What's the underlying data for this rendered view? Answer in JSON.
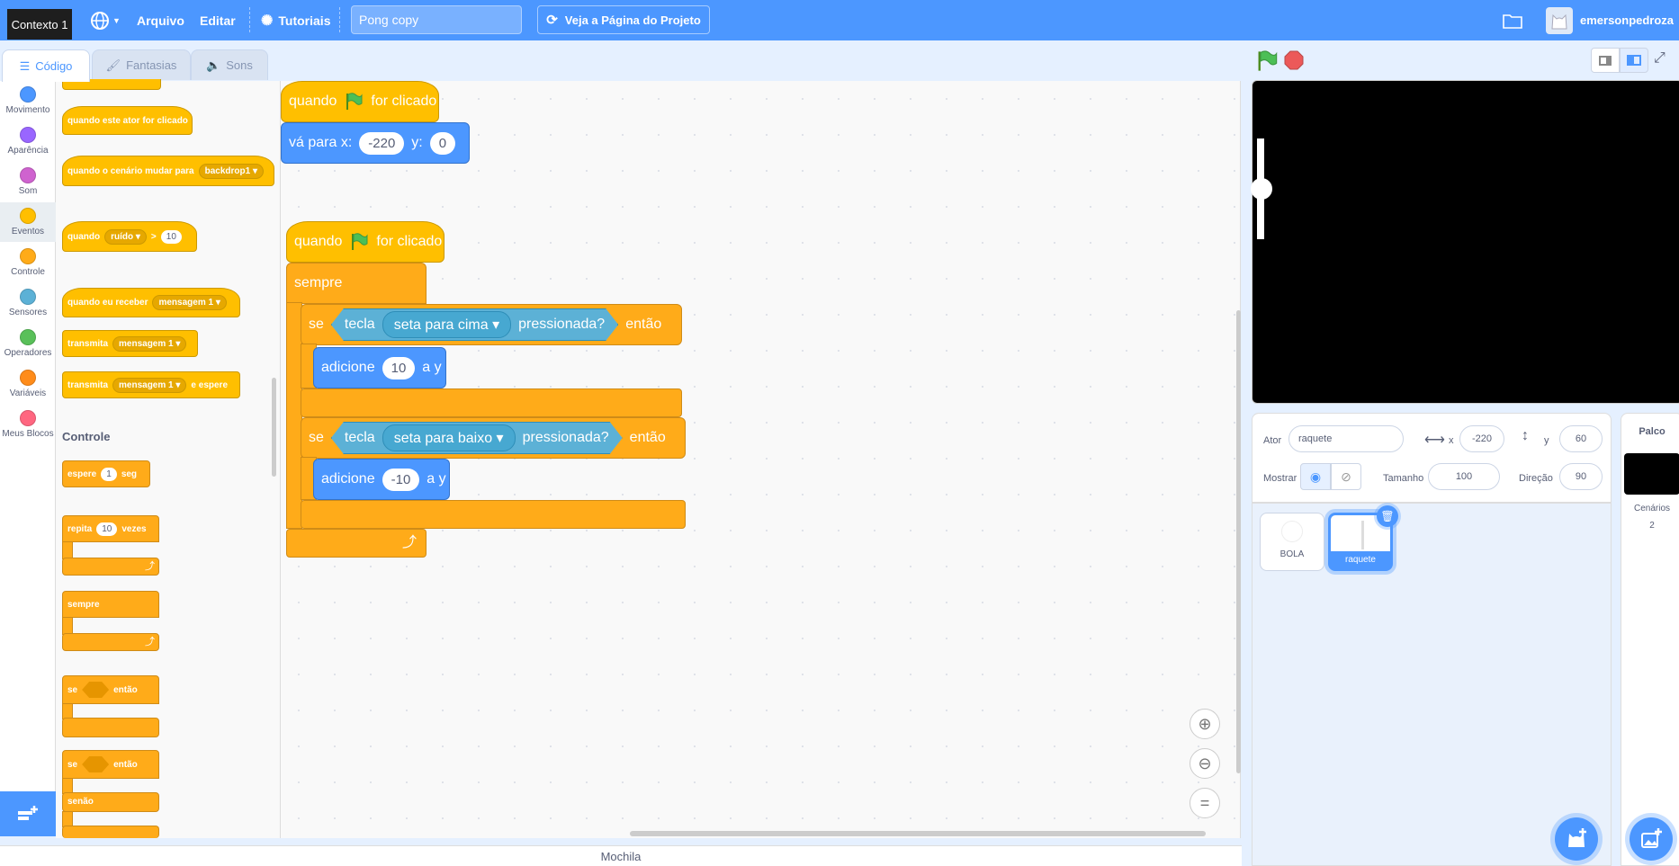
{
  "menubar": {
    "tooltip": "Contexto 1",
    "file": "Arquivo",
    "edit": "Editar",
    "tutorials": "Tutoriais",
    "project_title": "Pong copy",
    "project_page": "Veja a Página do Projeto",
    "username": "emersonpedroza"
  },
  "tabs": {
    "code": "Código",
    "costumes": "Fantasias",
    "sounds": "Sons"
  },
  "categories": [
    {
      "label": "Movimento",
      "color": "#4c97ff"
    },
    {
      "label": "Aparência",
      "color": "#9966ff"
    },
    {
      "label": "Som",
      "color": "#cf63cf"
    },
    {
      "label": "Eventos",
      "color": "#ffbf00"
    },
    {
      "label": "Controle",
      "color": "#ffab19"
    },
    {
      "label": "Sensores",
      "color": "#5cb1d6"
    },
    {
      "label": "Operadores",
      "color": "#59c059"
    },
    {
      "label": "Variáveis",
      "color": "#ff8c1a"
    },
    {
      "label": "Meus Blocos",
      "color": "#ff6680"
    }
  ],
  "palette": {
    "sprite_clicked": "quando este ator for clicado",
    "backdrop_switch": "quando o cenário mudar para",
    "backdrop_value": "backdrop1",
    "when": "quando",
    "loudness": "ruído",
    "gt": ">",
    "gt_value": "10",
    "receive": "quando eu receber",
    "message": "mensagem 1",
    "broadcast": "transmita",
    "broadcast_wait_suffix": "e espere",
    "control_header": "Controle",
    "wait": "espere",
    "wait_value": "1",
    "wait_unit": "seg",
    "repeat": "repita",
    "repeat_value": "10",
    "repeat_suffix": "vezes",
    "forever": "sempre",
    "if": "se",
    "then": "então",
    "else": "senão"
  },
  "script": {
    "when": "quando",
    "flag_clicked": "for clicado",
    "goto": "vá para x:",
    "goto_x": "-220",
    "goto_y_label": "y:",
    "goto_y": "0",
    "forever": "sempre",
    "if": "se",
    "key": "tecla",
    "key_up": "seta para cima",
    "key_down": "seta para baixo",
    "pressed": "pressionada?",
    "then": "então",
    "change": "adicione",
    "change_up_value": "10",
    "change_down_value": "-10",
    "to_y": "a y"
  },
  "backpack": "Mochila",
  "sprite_info": {
    "sprite_label": "Ator",
    "sprite_name": "raquete",
    "x_label": "x",
    "x_value": "-220",
    "y_label": "y",
    "y_value": "60",
    "show_label": "Mostrar",
    "size_label": "Tamanho",
    "size_value": "100",
    "direction_label": "Direção",
    "direction_value": "90"
  },
  "sprites": [
    {
      "name": "BOLA",
      "selected": false
    },
    {
      "name": "raquete",
      "selected": true
    }
  ],
  "stage_pane": {
    "title": "Palco",
    "backdrops_label": "Cenários",
    "backdrops_count": "2"
  }
}
